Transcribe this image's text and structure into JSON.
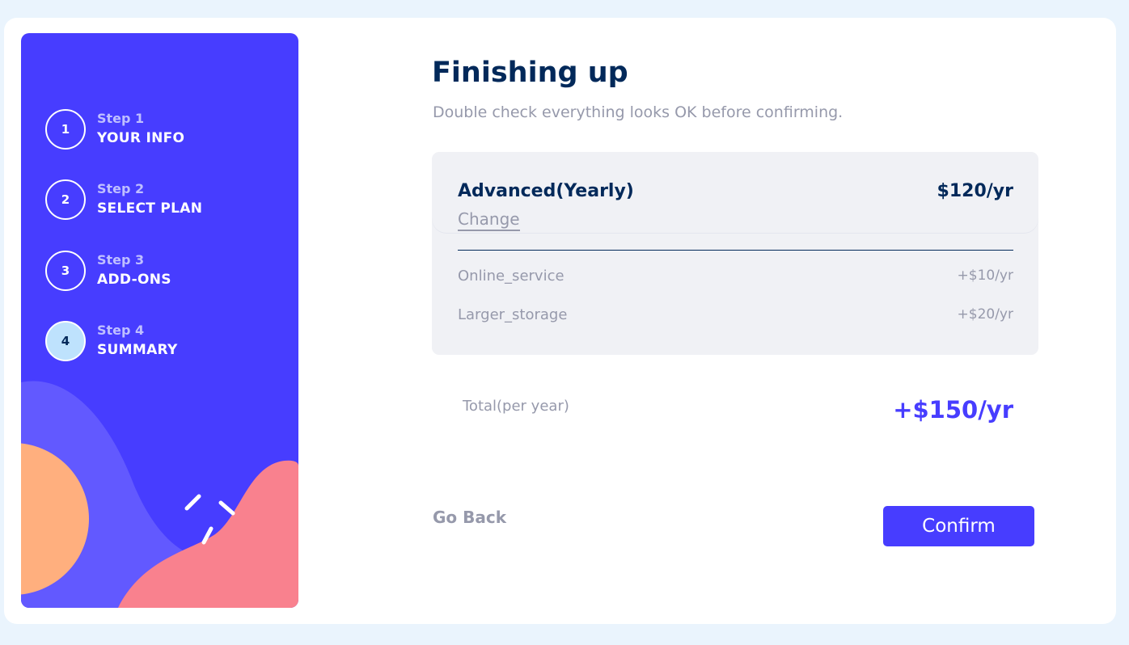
{
  "steps": [
    {
      "number": "1",
      "caption": "Step 1",
      "title": "YOUR INFO",
      "active": false
    },
    {
      "number": "2",
      "caption": "Step 2",
      "title": "SELECT PLAN",
      "active": false
    },
    {
      "number": "3",
      "caption": "Step 3",
      "title": "ADD-ONS",
      "active": false
    },
    {
      "number": "4",
      "caption": "Step 4",
      "title": "SUMMARY",
      "active": true
    }
  ],
  "header": {
    "title": "Finishing up",
    "subtitle": "Double check everything looks OK before confirming."
  },
  "summary": {
    "plan_name": "Advanced(Yearly)",
    "plan_price": "$120/yr",
    "change_label": "Change",
    "addons": [
      {
        "name": "Online_service",
        "price": "+$10/yr"
      },
      {
        "name": "Larger_storage",
        "price": "+$20/yr"
      }
    ]
  },
  "total": {
    "label": "Total(per year)",
    "value": "+$150/yr"
  },
  "actions": {
    "back_label": "Go Back",
    "confirm_label": "Confirm"
  },
  "colors": {
    "accent": "#473dff",
    "marine_blue": "#02295a",
    "cool_gray": "#9699ab",
    "light_blue": "#bee2fd",
    "magnolia": "#f0f1f5"
  }
}
